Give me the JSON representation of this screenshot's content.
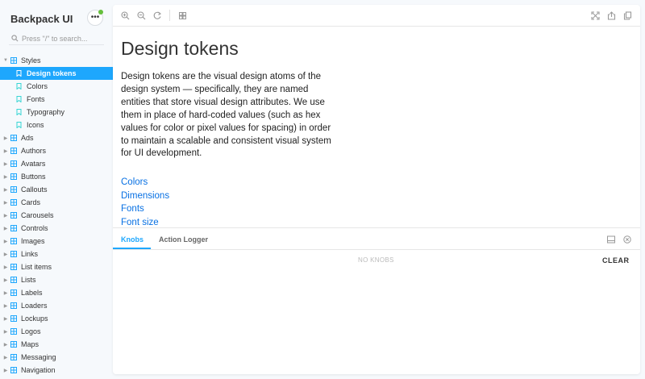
{
  "sidebar": {
    "brand": "Backpack UI",
    "menu_icon": "ellipsis-icon",
    "search_placeholder": "Press \"/\" to search...",
    "groups": [
      {
        "label": "Styles",
        "expanded": true,
        "children": [
          {
            "label": "Design tokens",
            "selected": true
          },
          {
            "label": "Colors"
          },
          {
            "label": "Fonts"
          },
          {
            "label": "Typography"
          },
          {
            "label": "Icons"
          }
        ]
      },
      {
        "label": "Ads"
      },
      {
        "label": "Authors"
      },
      {
        "label": "Avatars"
      },
      {
        "label": "Buttons"
      },
      {
        "label": "Callouts"
      },
      {
        "label": "Cards"
      },
      {
        "label": "Carousels"
      },
      {
        "label": "Controls"
      },
      {
        "label": "Images"
      },
      {
        "label": "Links"
      },
      {
        "label": "List items"
      },
      {
        "label": "Lists"
      },
      {
        "label": "Labels"
      },
      {
        "label": "Loaders"
      },
      {
        "label": "Lockups"
      },
      {
        "label": "Logos"
      },
      {
        "label": "Maps"
      },
      {
        "label": "Messaging"
      },
      {
        "label": "Navigation"
      }
    ]
  },
  "toolbar": {
    "left_icons": [
      "zoom-in-icon",
      "zoom-out-icon",
      "reset-zoom-icon",
      "grid-icon"
    ],
    "right_icons": [
      "fullscreen-icon",
      "share-icon",
      "copy-icon"
    ]
  },
  "doc": {
    "title": "Design tokens",
    "description": "Design tokens are the visual design atoms of the design system — specifically, they are named entities that store visual design attributes. We use them in place of hard-coded values (such as hex values for color or pixel values for spacing) in order to maintain a scalable and consistent visual system for UI development.",
    "links": [
      "Colors",
      "Dimensions",
      "Fonts",
      "Font size"
    ]
  },
  "addons": {
    "tabs": [
      "Knobs",
      "Action Logger"
    ],
    "active_tab": "Knobs",
    "empty_text": "NO KNOBS",
    "clear_label": "CLEAR",
    "icons": [
      "panel-layout-icon",
      "close-circle-icon"
    ]
  },
  "colors": {
    "accent": "#1ea7fd",
    "link": "#0770e3",
    "status_dot": "#66bf3c",
    "background": "#f6f9fc"
  }
}
